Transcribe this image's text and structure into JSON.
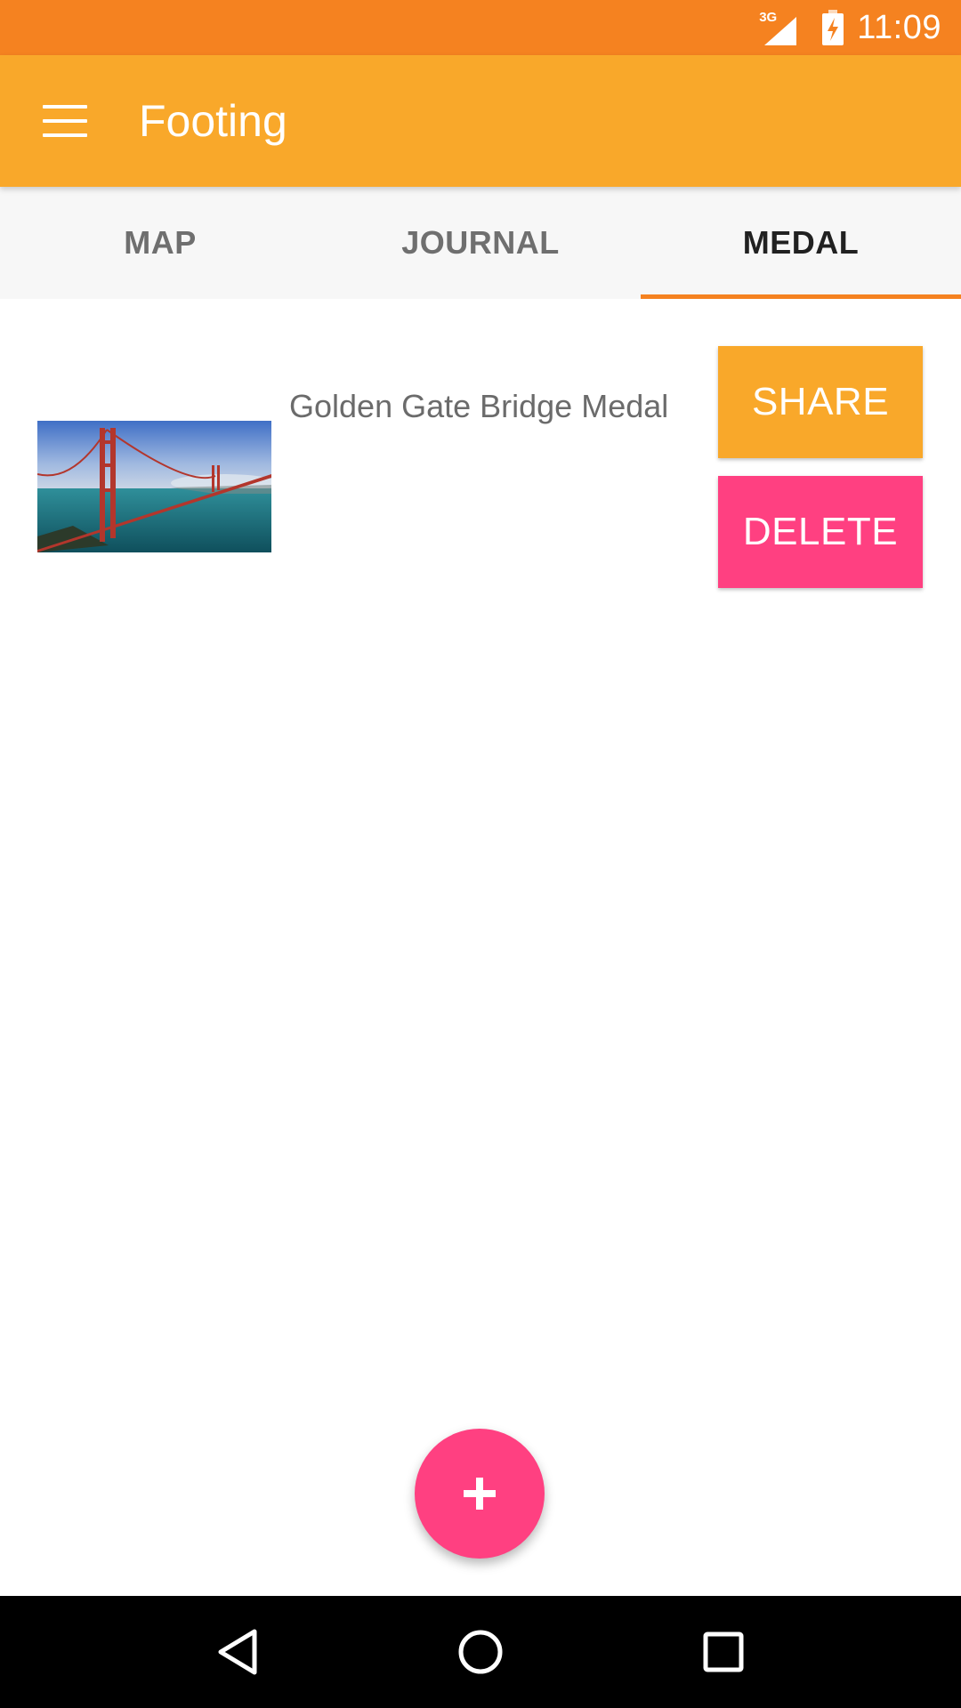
{
  "status_bar": {
    "network": "3G",
    "time": "11:09",
    "icons": [
      "signal-icon",
      "battery-charging-icon"
    ]
  },
  "app_bar": {
    "title": "Footing",
    "menu_icon": "hamburger-menu-icon"
  },
  "tabs": [
    {
      "label": "MAP",
      "active": false
    },
    {
      "label": "JOURNAL",
      "active": false
    },
    {
      "label": "MEDAL",
      "active": true
    }
  ],
  "medals": [
    {
      "name": "Golden Gate Bridge Medal",
      "image": "golden-gate-bridge-photo",
      "share_label": "SHARE",
      "delete_label": "DELETE"
    }
  ],
  "fab": {
    "icon": "add-icon"
  },
  "nav_bar": {
    "icons": [
      "back-icon",
      "home-icon",
      "recents-icon"
    ]
  },
  "colors": {
    "status_bar": "#F58220",
    "app_bar": "#F9A82A",
    "tab_indicator": "#F58220",
    "share_button": "#F9A82A",
    "delete_button": "#FF4081",
    "fab": "#FF4081"
  }
}
